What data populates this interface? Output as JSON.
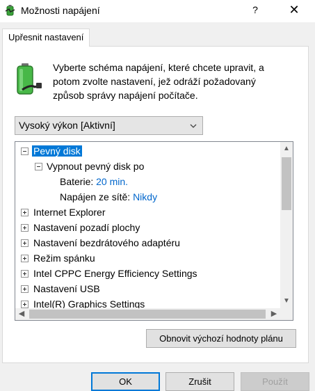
{
  "window": {
    "title": "Možnosti napájení",
    "help": "?",
    "close": "✕"
  },
  "tab": {
    "label": "Upřesnit nastavení"
  },
  "description": "Vyberte schéma napájení, které chcete upravit, a potom zvolte nastavení, jež odráží požadovaný způsob správy napájení počítače.",
  "scheme": {
    "selected": "Vysoký výkon [Aktivní]"
  },
  "tree": {
    "disk": {
      "label": "Pevný disk",
      "child": "Vypnout pevný disk po",
      "battery_label": "Baterie:",
      "battery_value": "20 min.",
      "plugged_label": "Napájen ze sítě:",
      "plugged_value": "Nikdy"
    },
    "items": [
      "Internet Explorer",
      "Nastavení pozadí plochy",
      "Nastavení bezdrátového adaptéru",
      "Režim spánku",
      "Intel CPPC Energy Efficiency Settings",
      "Nastavení USB",
      "Intel(R) Graphics Settings"
    ]
  },
  "buttons": {
    "restore": "Obnovit výchozí hodnoty plánu",
    "ok": "OK",
    "cancel": "Zrušit",
    "apply": "Použít"
  }
}
